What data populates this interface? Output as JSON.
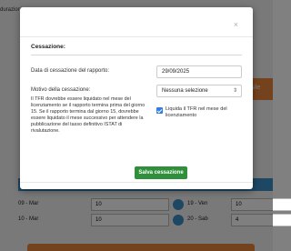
{
  "background": {
    "title": "durazioni",
    "orange_tab_label": "mensile",
    "rows": [
      {
        "date_left": "09 - Mar",
        "value_left": "10",
        "date_right": "19 - Ven",
        "value_right": "10"
      },
      {
        "date_left": "10 - Mar",
        "value_left": "10",
        "date_right": "20 - Sab",
        "value_right": "4"
      }
    ]
  },
  "modal": {
    "close_symbol": "×",
    "section_title": "Cessazione:",
    "end_date_label": "Data di cessazione del rapporto:",
    "end_date_value": "29/09/2025",
    "reason_label": "Motivo della cessazione:",
    "reason_selected": "Nessuna selezione",
    "note": "Il TFR dovrebbe essere liquidato nel mese del licenziamento se il rapporto termina prima del giorno 15. Se il rapporto termina dal giorno 15, dovrebbe essere liquidato il mese successivo per attendere la pubblicazione del tasso definitivo ISTAT di rivalutazione.",
    "checkbox_label": "Liquida il TFR nel mese del licenziamento",
    "checkbox_checked": true,
    "save_label": "Salva cessazione"
  },
  "colors": {
    "accent_green": "#2f8f3a",
    "checkbox_blue": "#2f7fe0",
    "orange": "#e8873c",
    "info_blue": "#3a8ec6"
  }
}
